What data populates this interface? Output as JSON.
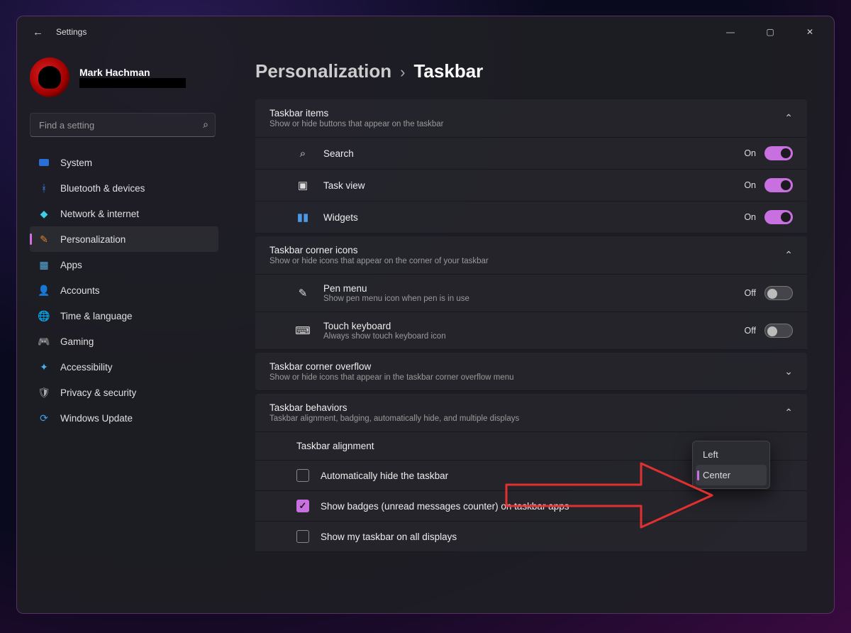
{
  "window": {
    "title": "Settings"
  },
  "profile": {
    "name": "Mark Hachman"
  },
  "search": {
    "placeholder": "Find a setting"
  },
  "nav": {
    "items": [
      {
        "label": "System"
      },
      {
        "label": "Bluetooth & devices"
      },
      {
        "label": "Network & internet"
      },
      {
        "label": "Personalization"
      },
      {
        "label": "Apps"
      },
      {
        "label": "Accounts"
      },
      {
        "label": "Time & language"
      },
      {
        "label": "Gaming"
      },
      {
        "label": "Accessibility"
      },
      {
        "label": "Privacy & security"
      },
      {
        "label": "Windows Update"
      }
    ],
    "active_index": 3
  },
  "breadcrumb": {
    "parent": "Personalization",
    "sep": "›",
    "current": "Taskbar"
  },
  "sections": {
    "taskbar_items": {
      "title": "Taskbar items",
      "subtitle": "Show or hide buttons that appear on the taskbar",
      "rows": [
        {
          "label": "Search",
          "state": "On"
        },
        {
          "label": "Task view",
          "state": "On"
        },
        {
          "label": "Widgets",
          "state": "On"
        }
      ]
    },
    "corner_icons": {
      "title": "Taskbar corner icons",
      "subtitle": "Show or hide icons that appear on the corner of your taskbar",
      "rows": [
        {
          "label": "Pen menu",
          "sub": "Show pen menu icon when pen is in use",
          "state": "Off"
        },
        {
          "label": "Touch keyboard",
          "sub": "Always show touch keyboard icon",
          "state": "Off"
        }
      ]
    },
    "overflow": {
      "title": "Taskbar corner overflow",
      "subtitle": "Show or hide icons that appear in the taskbar corner overflow menu"
    },
    "behaviors": {
      "title": "Taskbar behaviors",
      "subtitle": "Taskbar alignment, badging, automatically hide, and multiple displays",
      "alignment_label": "Taskbar alignment",
      "alignment_options": [
        "Left",
        "Center"
      ],
      "alignment_selected": "Center",
      "checks": [
        {
          "label": "Automatically hide the taskbar",
          "checked": false
        },
        {
          "label": "Show badges (unread messages counter) on taskbar apps",
          "checked": true
        },
        {
          "label": "Show my taskbar on all displays",
          "checked": false
        }
      ]
    }
  }
}
